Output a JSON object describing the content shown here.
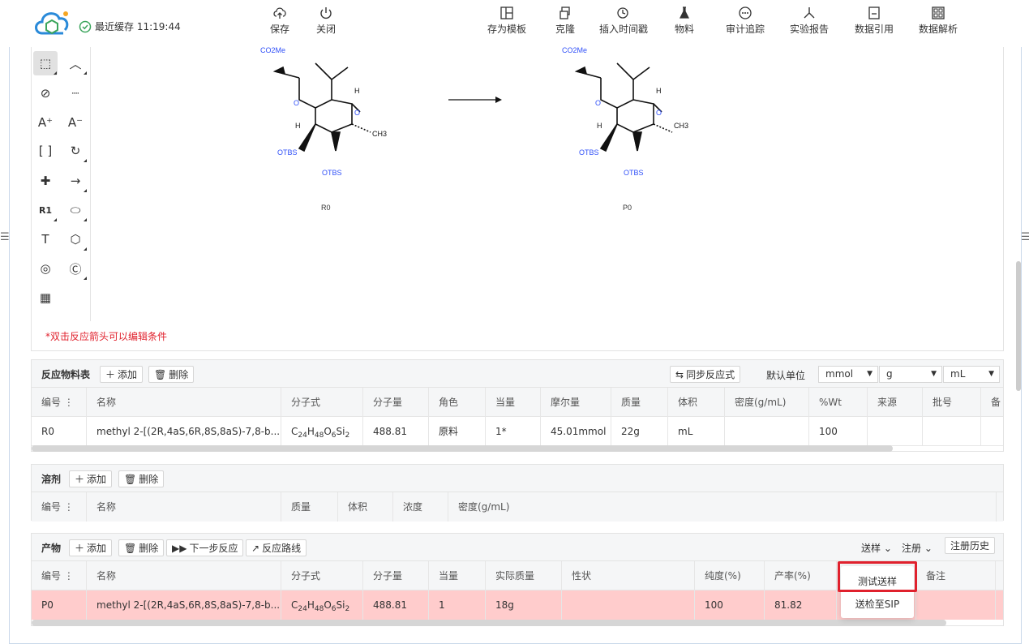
{
  "header": {
    "save_status": "最近缓存 11:19:44",
    "buttons": {
      "save": "保存",
      "close": "关闭",
      "save_template": "存为模板",
      "clone": "克隆",
      "insert_timestamp": "插入时间戳",
      "materials": "物料",
      "audit": "审计追踪",
      "report": "实验报告",
      "data_ref": "数据引用",
      "data_parse": "数据解析"
    }
  },
  "canvas": {
    "hint": "*双击反应箭头可以编辑条件",
    "reactant_label": "R0",
    "product_label": "P0",
    "labels": {
      "co2me": "CO2Me",
      "otbs": "OTBS",
      "h": "H",
      "o": "O",
      "ch3": "CH3"
    },
    "tools": [
      "rgroup-label",
      "R1"
    ]
  },
  "reaction_table": {
    "title": "反应物料表",
    "add": "添加",
    "delete": "删除",
    "sync": "同步反应式",
    "default_unit_label": "默认单位",
    "units": [
      "mmol",
      "g",
      "mL"
    ],
    "columns": [
      "编号",
      "名称",
      "分子式",
      "分子量",
      "角色",
      "当量",
      "摩尔量",
      "质量",
      "体积",
      "密度(g/mL)",
      "%Wt",
      "来源",
      "批号",
      "备"
    ],
    "rows": [
      {
        "id": "R0",
        "name": "methyl 2-[(2R,4aS,6R,8S,8aS)-7,8-b...",
        "formula_parts": [
          "C",
          "24",
          "H",
          "48",
          "O",
          "6",
          "Si",
          "2"
        ],
        "mw": "488.81",
        "role": "原料",
        "eq": "1*",
        "mol": "45.01mmol",
        "mass": "22g",
        "volume": "mL",
        "density": "",
        "wt": "100"
      }
    ]
  },
  "solvent_table": {
    "title": "溶剂",
    "add": "添加",
    "delete": "删除",
    "columns": [
      "编号",
      "名称",
      "质量",
      "体积",
      "浓度",
      "密度(g/mL)"
    ]
  },
  "product_table": {
    "title": "产物",
    "add": "添加",
    "delete": "删除",
    "next_step": "下一步反应",
    "route": "反应路线",
    "send_sample": "送样",
    "register": "注册",
    "register_history": "注册历史",
    "columns": [
      "编号",
      "名称",
      "分子式",
      "分子量",
      "当量",
      "实际质量",
      "性状",
      "纯度(%)",
      "产率(%)",
      "备注"
    ],
    "rows": [
      {
        "id": "P0",
        "name": "methyl 2-[(2R,4aS,6R,8S,8aS)-7,8-b...",
        "formula_parts": [
          "C",
          "24",
          "H",
          "48",
          "O",
          "6",
          "Si",
          "2"
        ],
        "mw": "488.81",
        "eq": "1",
        "actual_mass": "18g",
        "appearance": "",
        "purity": "100",
        "yield": "81.82"
      }
    ]
  },
  "popup": {
    "items": [
      "测试送样",
      "送检至SIP"
    ]
  },
  "colors": {
    "accent_red": "#e0212d",
    "structure_blue": "#3050f8",
    "highlight_row": "#ffcccc"
  }
}
